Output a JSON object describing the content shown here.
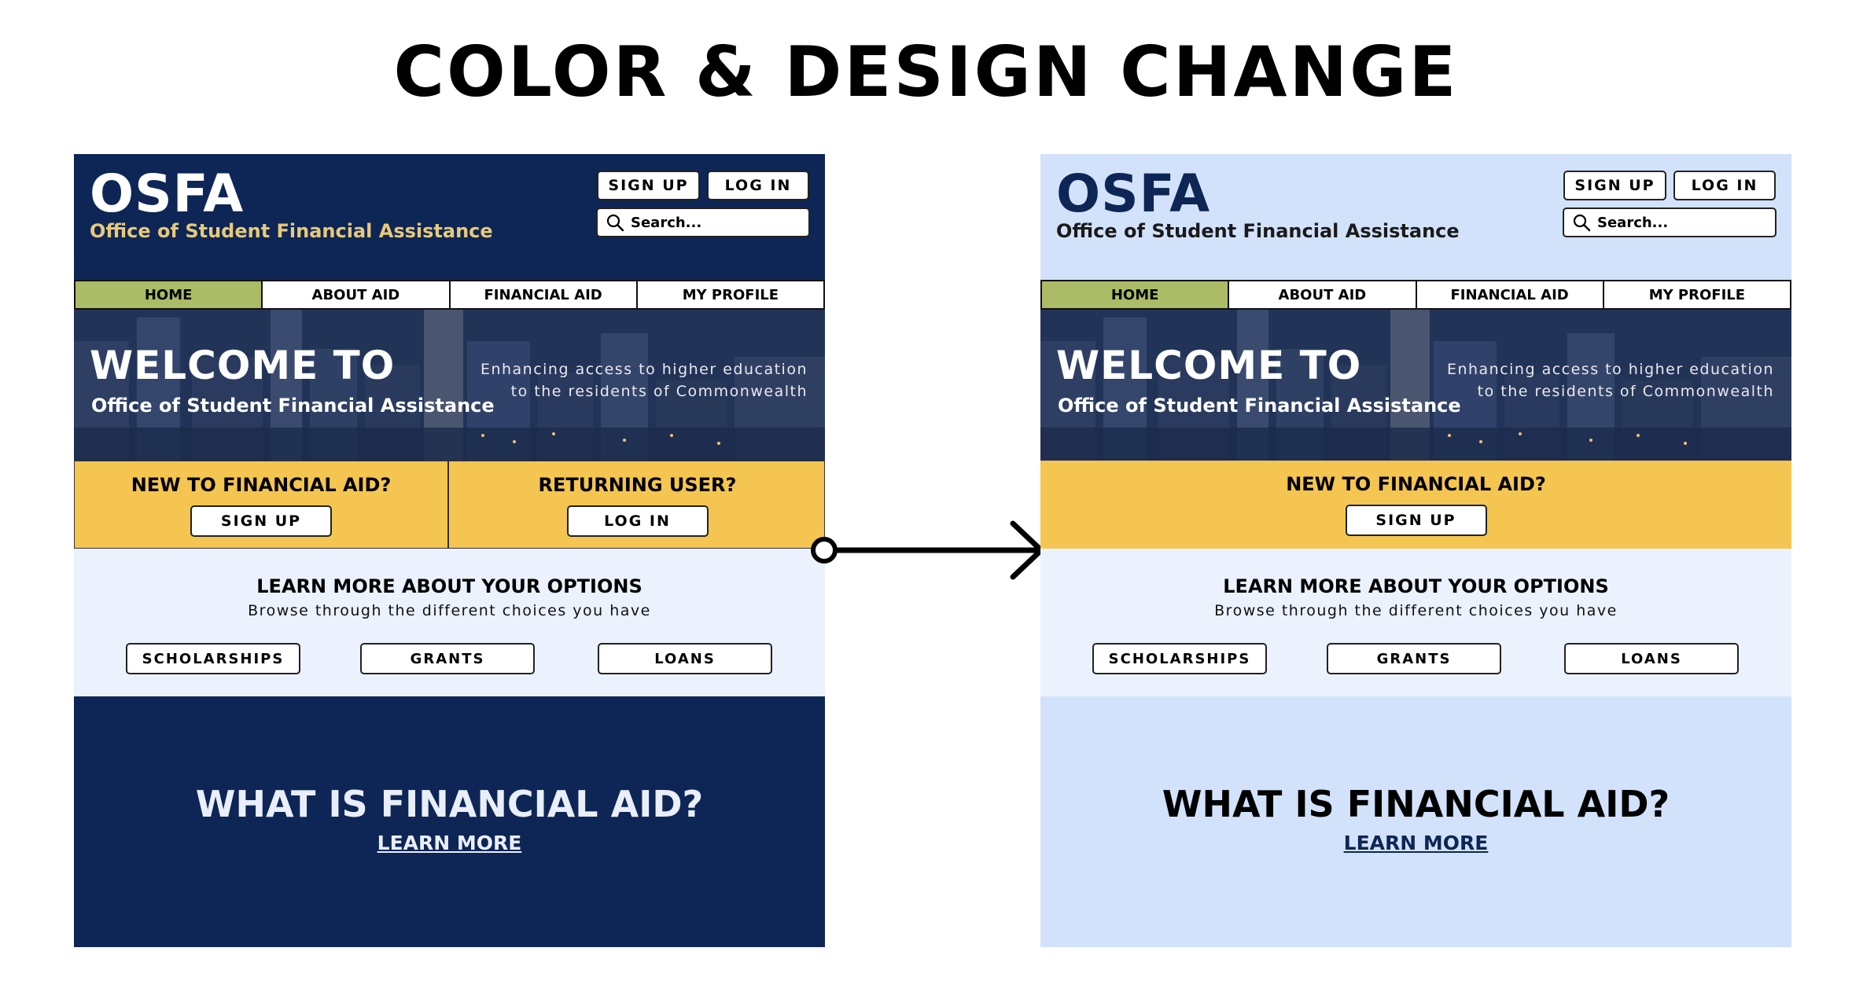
{
  "page_title": "COLOR & DESIGN CHANGE",
  "colors": {
    "navy": "#0d2655",
    "light_blue": "#d2e2fb",
    "pale_blue": "#ebf2fd",
    "gold": "#f4c551",
    "green_active": "#abbb66",
    "logo_sub_gold": "#e8c97a"
  },
  "before": {
    "header": {
      "logo": "OSFA",
      "subtitle": "Office of Student Financial Assistance",
      "signup_label": "SIGN UP",
      "login_label": "LOG IN",
      "search_placeholder": "Search..."
    },
    "nav": [
      "HOME",
      "ABOUT AID",
      "FINANCIAL AID",
      "MY PROFILE"
    ],
    "hero": {
      "welcome": "WELCOME TO",
      "subtitle": "Office of Student Financial Assistance",
      "tagline_1": "Enhancing access to higher education",
      "tagline_2": "to the residents of Commonwealth"
    },
    "cta_new": {
      "title": "NEW TO FINANCIAL AID?",
      "button": "SIGN UP"
    },
    "cta_returning": {
      "title": "RETURNING USER?",
      "button": "LOG IN"
    },
    "options": {
      "title": "LEARN MORE ABOUT YOUR OPTIONS",
      "subtitle": "Browse through the different choices you have",
      "buttons": [
        "SCHOLARSHIPS",
        "GRANTS",
        "LOANS"
      ]
    },
    "footer": {
      "title": "WHAT IS FINANCIAL AID?",
      "link": "LEARN MORE"
    }
  },
  "after": {
    "header": {
      "logo": "OSFA",
      "subtitle": "Office of Student Financial Assistance",
      "signup_label": "SIGN UP",
      "login_label": "LOG IN",
      "search_placeholder": "Search..."
    },
    "nav": [
      "HOME",
      "ABOUT AID",
      "FINANCIAL AID",
      "MY PROFILE"
    ],
    "hero": {
      "welcome": "WELCOME TO",
      "subtitle": "Office of Student Financial Assistance",
      "tagline_1": "Enhancing access to higher education",
      "tagline_2": "to the residents of Commonwealth"
    },
    "cta_new": {
      "title": "NEW TO FINANCIAL AID?",
      "button": "SIGN UP"
    },
    "options": {
      "title": "LEARN MORE ABOUT YOUR OPTIONS",
      "subtitle": "Browse through the different choices you have",
      "buttons": [
        "SCHOLARSHIPS",
        "GRANTS",
        "LOANS"
      ]
    },
    "footer": {
      "title": "WHAT IS FINANCIAL AID?",
      "link": "LEARN MORE"
    }
  },
  "icons": {
    "search": "search-icon",
    "arrow": "arrow-right-icon"
  }
}
